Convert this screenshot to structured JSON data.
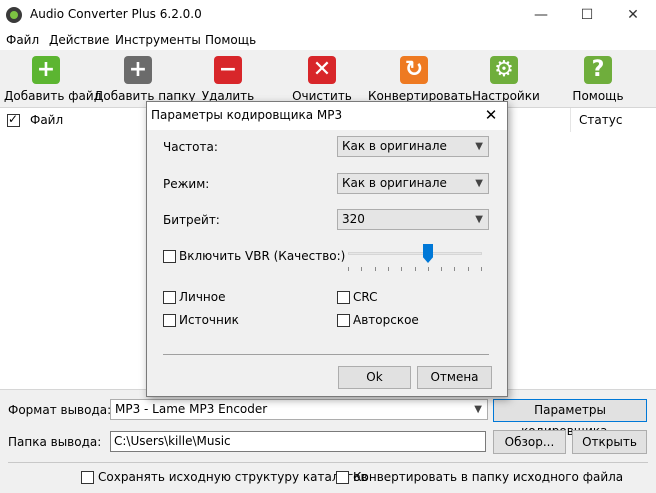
{
  "window": {
    "title": "Audio Converter Plus 6.2.0.0",
    "minimize": "—",
    "maximize": "☐",
    "close": "✕"
  },
  "menu": [
    "Файл",
    "Действие",
    "Инструменты",
    "Помощь"
  ],
  "toolbar": [
    {
      "label": "Добавить файл",
      "icon": "add-file-icon",
      "glyph": "+",
      "color": "#5cb531"
    },
    {
      "label": "Добавить папку",
      "icon": "add-folder-icon",
      "glyph": "+",
      "color": "#6b6b6b"
    },
    {
      "label": "Удалить",
      "icon": "delete-icon",
      "glyph": "−",
      "color": "#d8262a"
    },
    {
      "label": "Очистить",
      "icon": "clear-icon",
      "glyph": "✕",
      "color": "#d8262a"
    },
    {
      "label": "Конвертировать",
      "icon": "convert-icon",
      "glyph": "↻",
      "color": "#ee7a22"
    },
    {
      "label": "Настройки",
      "icon": "settings-icon",
      "glyph": "⚙",
      "color": "#6fae3c"
    },
    {
      "label": "Помощь",
      "icon": "help-icon",
      "glyph": "?",
      "color": "#6fae3c"
    }
  ],
  "filelist": {
    "col_file": "Файл",
    "col_status": "Статус",
    "all_checked": true
  },
  "bottom": {
    "format_label": "Формат вывода:",
    "format_value": "MP3   - Lame MP3 Encoder",
    "encoder_params_button": "Параметры кодировщика...",
    "folder_label": "Папка вывода:",
    "folder_value": "C:\\Users\\kille\\Music",
    "browse_button": "Обзор...",
    "open_button": "Открыть",
    "keep_structure": "Сохранять исходную структуру каталогов",
    "convert_to_source": "Конвертировать в папку исходного файла"
  },
  "dialog": {
    "title": "Параметры кодировщика MP3",
    "close": "✕",
    "frequency_label": "Частота:",
    "frequency_value": "Как в оригинале",
    "mode_label": "Режим:",
    "mode_value": "Как в оригинале",
    "bitrate_label": "Битрейт:",
    "bitrate_value": "320",
    "vbr_label": "Включить VBR (Качество:)",
    "vbr_quality": 0.6,
    "private_label": "Личное",
    "crc_label": "CRC",
    "original_label": "Источник",
    "copyright_label": "Авторское",
    "ok_button": "Ok",
    "cancel_button": "Отмена"
  }
}
